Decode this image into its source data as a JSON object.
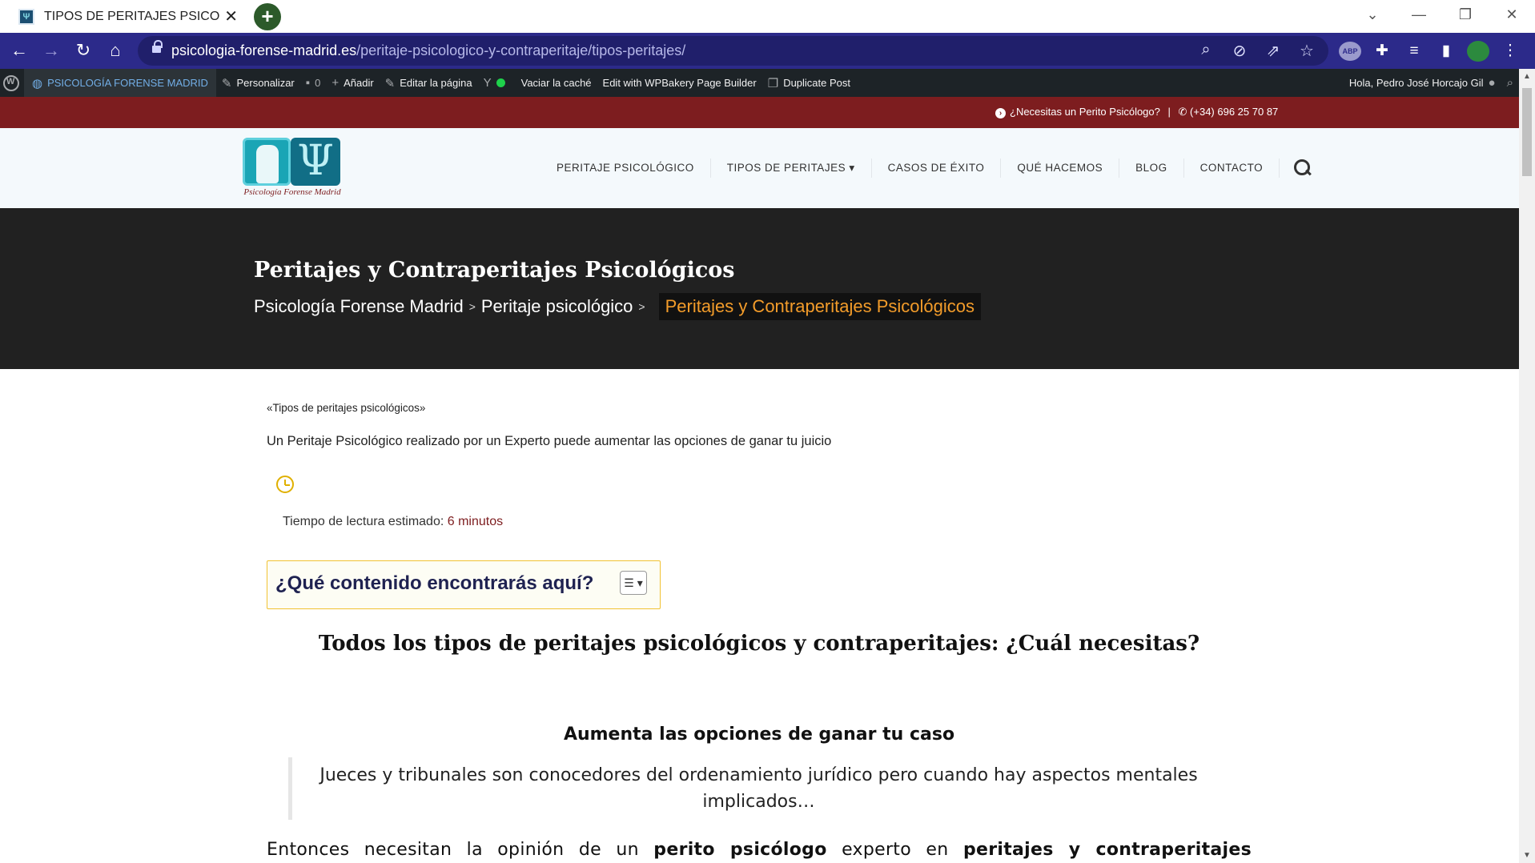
{
  "browser": {
    "tab_title": "TIPOS DE PERITAJES PSICOLÓGIC",
    "tab_close": "✕",
    "newtab_label": "+",
    "url_host": "psicologia-forense-madrid.es",
    "url_path": "/peritaje-psicologico-y-contraperitaje/tipos-peritajes/",
    "window_controls": [
      "⌄",
      "—",
      "❐",
      "✕"
    ]
  },
  "adminbar": {
    "site": "PSICOLOGÍA FORENSE MADRID",
    "customize": "Personalizar",
    "comments_count": "0",
    "add_new": "Añadir",
    "edit_page": "Editar la página",
    "clear_cache": "Vaciar la caché",
    "wpbakery": "Edit with WPBakery Page Builder",
    "duplicate": "Duplicate Post",
    "greeting": "Hola, Pedro José Horcajo Gil"
  },
  "topbar": {
    "question": "¿Necesitas un Perito Psicólogo?",
    "separator": "|",
    "phone": "(+34) 696 25 70 87"
  },
  "header": {
    "logo_text": "Psicología Forense Madrid",
    "logo_glyph": "Ψ",
    "nav": [
      {
        "label": "PERITAJE PSICOLÓGICO"
      },
      {
        "label": "TIPOS DE PERITAJES ▾"
      },
      {
        "label": "CASOS DE ÉXITO"
      },
      {
        "label": "QUÉ HACEMOS"
      },
      {
        "label": "BLOG"
      },
      {
        "label": "CONTACTO"
      }
    ]
  },
  "hero": {
    "title": "Peritajes y Contraperitajes Psicológicos",
    "breadcrumbs": [
      "Psicología Forense Madrid",
      "Peritaje psicológico",
      "Peritajes y Contraperitajes Psicológicos"
    ],
    "separator": ">"
  },
  "content": {
    "quote": "«Tipos de peritajes psicológicos»",
    "lead": "Un Peritaje Psicológico realizado por un Experto puede aumentar las opciones de ganar tu juicio",
    "reading_label": "Tiempo de lectura estimado:",
    "reading_value": "6 minutos",
    "toc_title": "¿Qué contenido encontrarás aquí?",
    "toc_toggle": "☰ ▾",
    "h2": "Todos los tipos de peritajes psicológicos y contraperitajes: ¿Cuál necesitas?",
    "h3": "Aumenta las opciones de ganar tu caso",
    "blockquote": "Jueces y tribunales son conocedores del ordenamiento jurídico pero cuando hay aspectos mentales implicados…",
    "para_1": "Entonces necesitan la opinión de un",
    "para_b1": "perito psicólogo",
    "para_2": "experto en",
    "para_b2": "peritajes y contraperitajes"
  },
  "colors": {
    "toolbar": "#2c2a8a",
    "topbar": "#7d1d1f",
    "hero_bg": "#212121",
    "breadcrumb_active": "#f39c2a",
    "toc_border": "#f1c232"
  }
}
